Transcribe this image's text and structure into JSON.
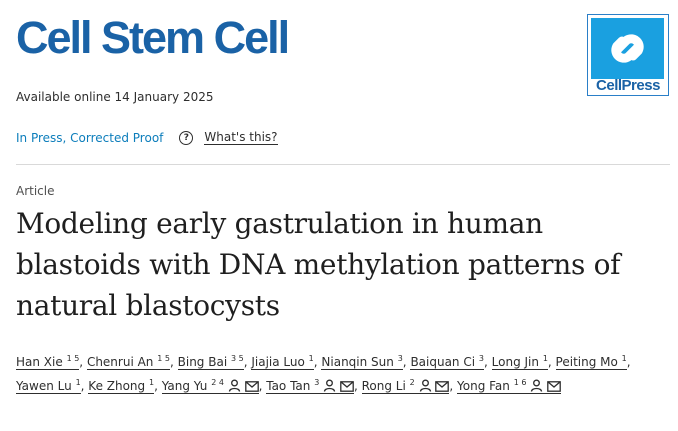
{
  "journal": {
    "title": "Cell Stem Cell",
    "publisher_logo_text": "CellPress",
    "brand_color": "#1a62a6",
    "logo_color": "#1aa0e0"
  },
  "availability": "Available online 14 January 2025",
  "status": {
    "link_text": "In Press, Corrected Proof",
    "help_icon": "question-circle-icon",
    "help_text": "What's this?"
  },
  "article": {
    "type": "Article",
    "title": "Modeling early gastrulation in human blastoids with DNA methylation patterns of natural blastocysts"
  },
  "authors": [
    {
      "name": "Han Xie",
      "sup": "1 5",
      "person": false,
      "mail": false
    },
    {
      "name": "Chenrui An",
      "sup": "1 5",
      "person": false,
      "mail": false
    },
    {
      "name": "Bing Bai",
      "sup": "3 5",
      "person": false,
      "mail": false
    },
    {
      "name": "Jiajia Luo",
      "sup": "1",
      "person": false,
      "mail": false
    },
    {
      "name": "Nianqin Sun",
      "sup": "3",
      "person": false,
      "mail": false
    },
    {
      "name": "Baiquan Ci",
      "sup": "3",
      "person": false,
      "mail": false
    },
    {
      "name": "Long Jin",
      "sup": "1",
      "person": false,
      "mail": false
    },
    {
      "name": "Peiting Mo",
      "sup": "1",
      "person": false,
      "mail": false
    },
    {
      "name": "Yawen Lu",
      "sup": "1",
      "person": false,
      "mail": false
    },
    {
      "name": "Ke Zhong",
      "sup": "1",
      "person": false,
      "mail": false
    },
    {
      "name": "Yang Yu",
      "sup": "2 4",
      "person": true,
      "mail": true
    },
    {
      "name": "Tao Tan",
      "sup": "3",
      "person": true,
      "mail": true
    },
    {
      "name": "Rong Li",
      "sup": "2",
      "person": true,
      "mail": true
    },
    {
      "name": "Yong Fan",
      "sup": "1 6",
      "person": true,
      "mail": true
    }
  ],
  "author_icons": {
    "person": "person-icon",
    "mail": "envelope-icon"
  }
}
